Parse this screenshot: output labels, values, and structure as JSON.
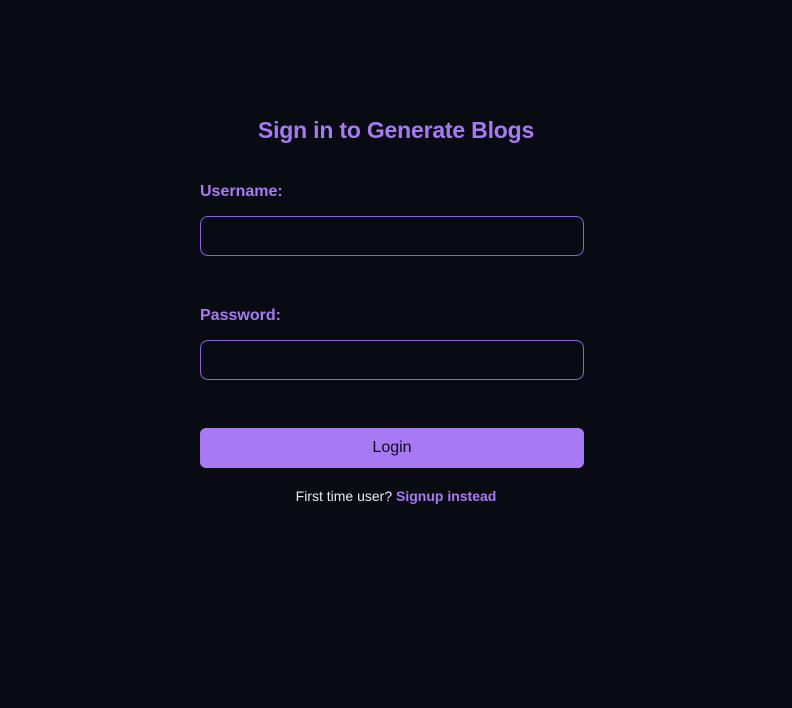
{
  "login_form": {
    "title": "Sign in to Generate Blogs",
    "username_label": "Username:",
    "username_value": "",
    "password_label": "Password:",
    "password_value": "",
    "login_button_label": "Login",
    "signup_prompt": "First time user?",
    "signup_link_label": "Signup instead"
  },
  "colors": {
    "background": "#090b12",
    "accent": "#a879f4",
    "input_border": "#8e63e0",
    "text_light": "#e9e9ee",
    "button_text": "#0c0d14"
  }
}
